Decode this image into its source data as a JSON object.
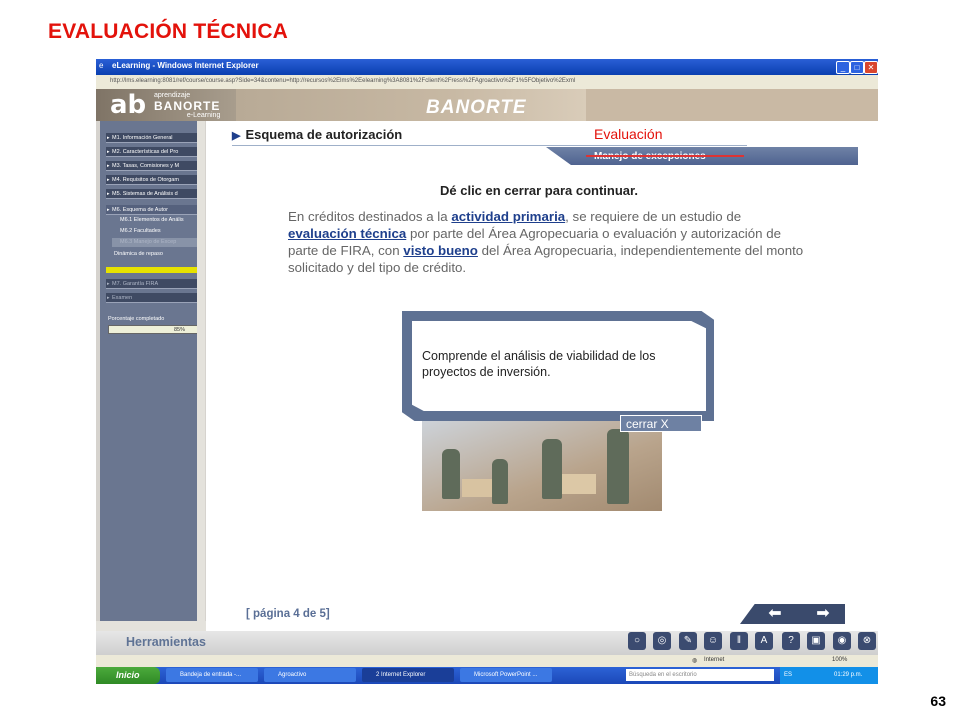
{
  "slide": {
    "title": "EVALUACIÓN TÉCNICA",
    "page_number": "63"
  },
  "window": {
    "title": "eLearning - Windows Internet Explorer",
    "address": "http://lms.elearning:8081/ref/course/course.asp?Side=34&contenu=http://recursos%2Elms%2Eelearning%3A8081%2Fclient%2Fress%2FAgroactivo%2F1%5FObjetivo%2Exml"
  },
  "banner": {
    "logo_mark": "ab",
    "logo_line1": "aprendizaje",
    "logo_line2": "BANORTE",
    "logo_line3": "e-Learning",
    "brand": "BANORTE"
  },
  "sidebar": {
    "items": [
      {
        "label": "M1. Información General"
      },
      {
        "label": "M2. Características del Pro"
      },
      {
        "label": "M3. Tasas, Comisiones y M"
      },
      {
        "label": "M4. Requisitos de Otorgam"
      },
      {
        "label": "M5. Sistemas de Análisis d"
      }
    ],
    "current_module": "M6. Esquema de Autor",
    "sub_items": [
      {
        "label": "M6.1 Elementos de Anális"
      },
      {
        "label": "M6.2 Facultades"
      },
      {
        "label": "M6.3 Manejo de Excep"
      },
      {
        "label": "Dinámica de repaso"
      }
    ],
    "later_items": [
      {
        "label": "M7. Garantía FIRA"
      },
      {
        "label": "Examen"
      }
    ],
    "progress_label": "Porcentaje completado",
    "progress_value": "85%"
  },
  "content": {
    "header": "Esquema de autorización",
    "tab_label": "Manejo de excepciones",
    "overlay_label": "Evaluación",
    "instruction": "Dé clic en cerrar para continuar.",
    "body": {
      "p1": "En créditos destinados a la ",
      "link1": "actividad primaria",
      "p2": ", se requiere de un estudio de ",
      "link2": "evaluación técnica",
      "p3": " por parte del Área Agropecuaria o evaluación y autorización de parte de FIRA, con ",
      "link3": "visto bueno",
      "p4": " del Área Agropecuaria, independientemente del monto solicitado y del tipo de crédito."
    },
    "popup_text": "Comprende el análisis de viabilidad de los proyectos de inversión.",
    "close_label": "cerrar X",
    "pagination": "[ página 4 de 5]",
    "prev_icon": "arrow-left-icon",
    "next_icon": "arrow-right-icon"
  },
  "toolbar": {
    "label": "Herramientas",
    "icons": [
      "lightbulb-icon",
      "glossary-icon",
      "notes-icon",
      "contact-icon",
      "library-icon",
      "font-size-icon",
      "help-icon",
      "book-icon",
      "view-icon",
      "close-icon"
    ]
  },
  "status": {
    "zone": "Internet",
    "zoom": "100%"
  },
  "taskbar": {
    "start": "Inicio",
    "tasks": [
      {
        "label": "Bandeja de entrada -..."
      },
      {
        "label": "Agroactivo"
      },
      {
        "label": "2 Internet Explorer"
      },
      {
        "label": "Microsoft PowerPoint ..."
      }
    ],
    "search_placeholder": "Búsqueda en el escritorio",
    "language": "ES",
    "clock": "01:29 p.m."
  }
}
